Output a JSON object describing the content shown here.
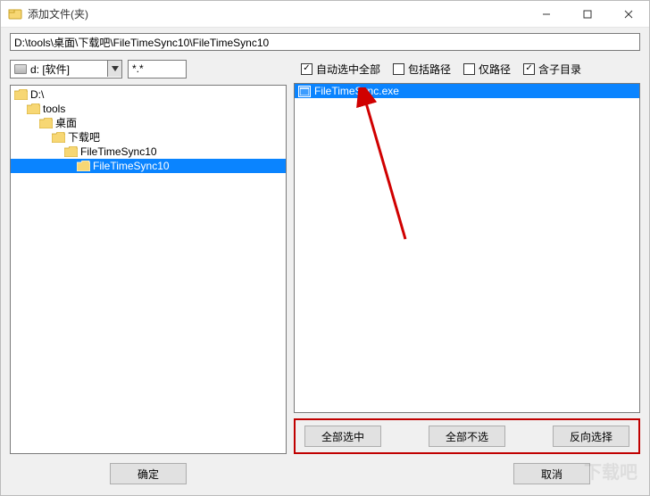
{
  "title": "添加文件(夹)",
  "path_value": "D:\\tools\\桌面\\下载吧\\FileTimeSync10\\FileTimeSync10",
  "drive_label": "d: [软件]",
  "filter_value": "*.*",
  "tree": [
    {
      "indent": 0,
      "label": "D:\\",
      "open": true,
      "selected": false
    },
    {
      "indent": 1,
      "label": "tools",
      "open": true,
      "selected": false
    },
    {
      "indent": 2,
      "label": "桌面",
      "open": true,
      "selected": false
    },
    {
      "indent": 3,
      "label": "下载吧",
      "open": true,
      "selected": false
    },
    {
      "indent": 4,
      "label": "FileTimeSync10",
      "open": true,
      "selected": false
    },
    {
      "indent": 5,
      "label": "FileTimeSync10",
      "open": true,
      "selected": true
    }
  ],
  "checks": {
    "auto_select_all": {
      "label": "自动选中全部",
      "checked": true
    },
    "include_path": {
      "label": "包括路径",
      "checked": false
    },
    "only_path": {
      "label": "仅路径",
      "checked": false
    },
    "include_subdir": {
      "label": "含子目录",
      "checked": true
    }
  },
  "files": [
    {
      "name": "FileTimeSync.exe",
      "selected": true
    }
  ],
  "selection_buttons": {
    "select_all": "全部选中",
    "deselect_all": "全部不选",
    "invert": "反向选择"
  },
  "bottom": {
    "ok": "确定",
    "cancel": "取消"
  },
  "watermark": "下载吧"
}
